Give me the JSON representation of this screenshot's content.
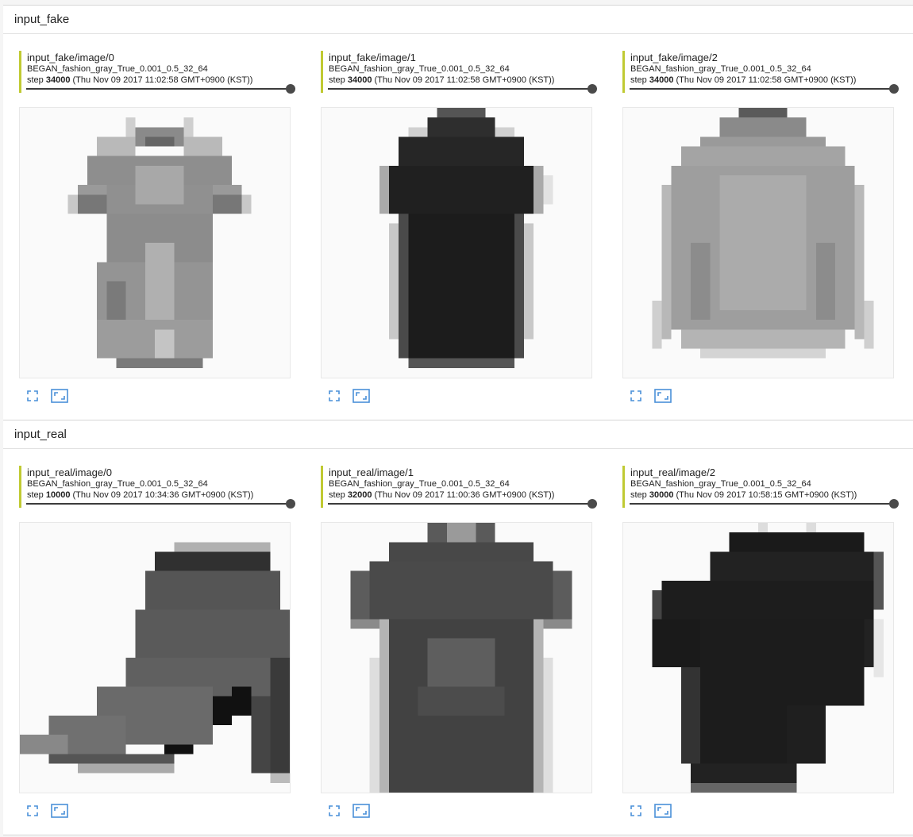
{
  "sections": [
    {
      "name": "input_fake",
      "cards": [
        {
          "title": "input_fake/image/0",
          "run": "BEGAN_fashion_gray_True_0.001_0.5_32_64",
          "step_label": "step",
          "step": "34000",
          "timestamp": "(Thu Nov 09 2017 11:02:58 GMT+0900 (KST))",
          "image": "fake-dress-gray"
        },
        {
          "title": "input_fake/image/1",
          "run": "BEGAN_fashion_gray_True_0.001_0.5_32_64",
          "step_label": "step",
          "step": "34000",
          "timestamp": "(Thu Nov 09 2017 11:02:58 GMT+0900 (KST))",
          "image": "fake-dress-black"
        },
        {
          "title": "input_fake/image/2",
          "run": "BEGAN_fashion_gray_True_0.001_0.5_32_64",
          "step_label": "step",
          "step": "34000",
          "timestamp": "(Thu Nov 09 2017 11:02:58 GMT+0900 (KST))",
          "image": "fake-shirt-gray"
        }
      ]
    },
    {
      "name": "input_real",
      "cards": [
        {
          "title": "input_real/image/0",
          "run": "BEGAN_fashion_gray_True_0.001_0.5_32_64",
          "step_label": "step",
          "step": "10000",
          "timestamp": "(Thu Nov 09 2017 10:34:36 GMT+0900 (KST))",
          "image": "real-ankle-boot"
        },
        {
          "title": "input_real/image/1",
          "run": "BEGAN_fashion_gray_True_0.001_0.5_32_64",
          "step_label": "step",
          "step": "32000",
          "timestamp": "(Thu Nov 09 2017 11:00:36 GMT+0900 (KST))",
          "image": "real-tshirt"
        },
        {
          "title": "input_real/image/2",
          "run": "BEGAN_fashion_gray_True_0.001_0.5_32_64",
          "step_label": "step",
          "step": "30000",
          "timestamp": "(Thu Nov 09 2017 10:58:15 GMT+0900 (KST))",
          "image": "real-tshirt-black"
        }
      ]
    }
  ],
  "icons": {
    "fullscreen": "fullscreen-icon",
    "fit": "fit-to-frame-icon"
  },
  "colors": {
    "accent": "#c0ca33",
    "icon": "#4a90d9",
    "slider": "#3c3c3c"
  }
}
